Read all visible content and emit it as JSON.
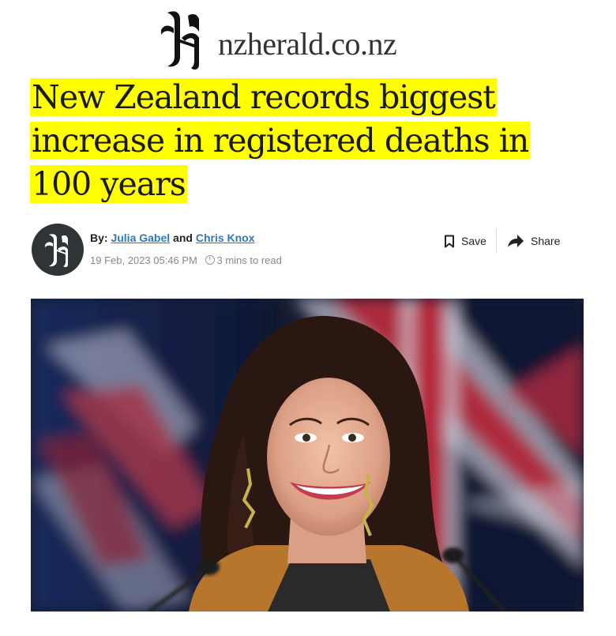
{
  "masthead": {
    "site_name": "nzherald.co.nz",
    "logo_icon": "gothic-h-logo"
  },
  "article": {
    "headline": "New Zealand records biggest increase in registered deaths in 100 years",
    "byline": {
      "prefix": "By:",
      "author1": "Julia Gabel",
      "conjunction": "and",
      "author2": "Chris Knox"
    },
    "date": "19 Feb, 2023 05:46 PM",
    "read_time": "3 mins to read",
    "actions": {
      "save_label": "Save",
      "share_label": "Share"
    },
    "highlight_color": "#ffff00",
    "link_color": "#2b78c5"
  }
}
